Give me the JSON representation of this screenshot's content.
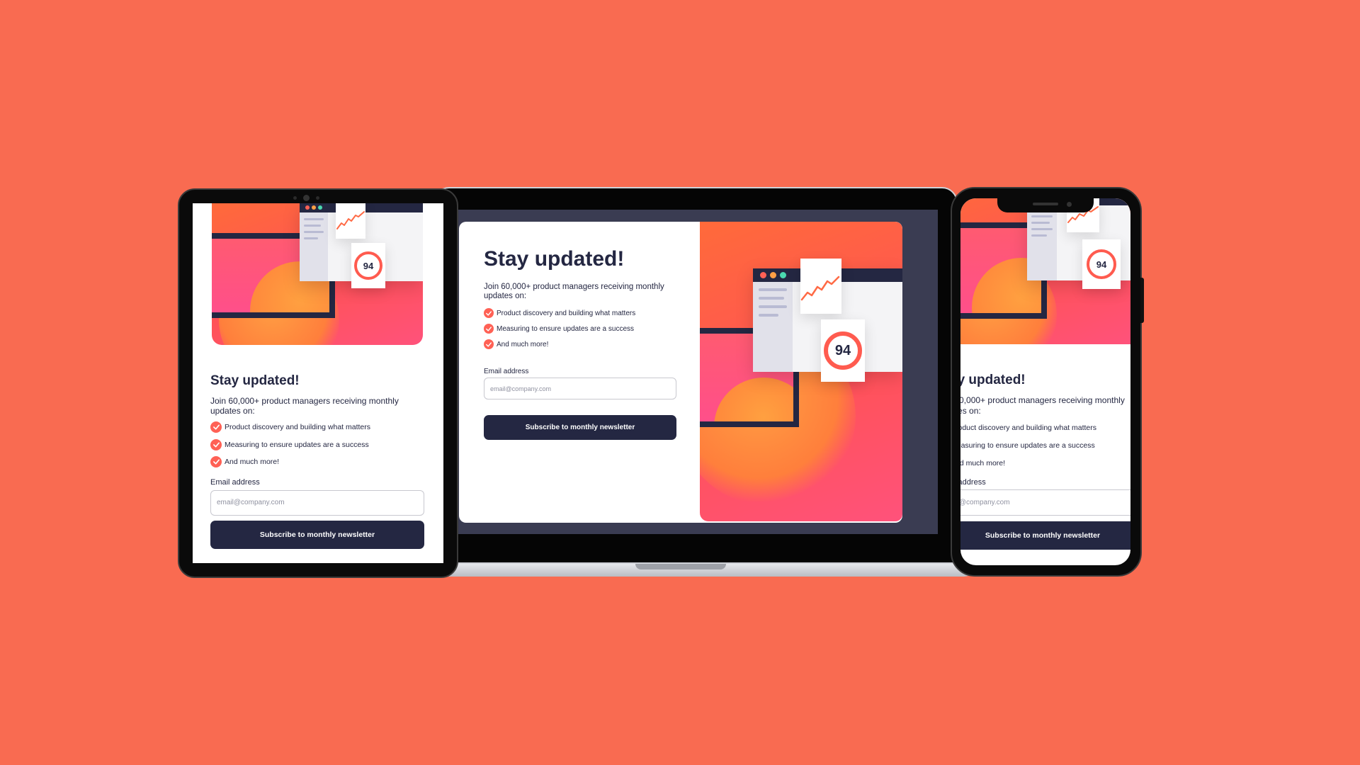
{
  "newsletter": {
    "title": "Stay updated!",
    "intro": "Join 60,000+ product managers receiving monthly updates on:",
    "bullets": [
      "Product discovery and building what matters",
      "Measuring to ensure updates are a success",
      "And much more!"
    ],
    "email_label": "Email address",
    "email_placeholder": "email@company.com",
    "subscribe_label": "Subscribe to monthly newsletter"
  },
  "illustration": {
    "score": "94"
  },
  "colors": {
    "background": "#f96b51",
    "dark_navy": "#242742",
    "accent_tomato": "#ff6155"
  },
  "icons": [
    "check-icon",
    "trend-line-icon",
    "score-ring-icon"
  ]
}
